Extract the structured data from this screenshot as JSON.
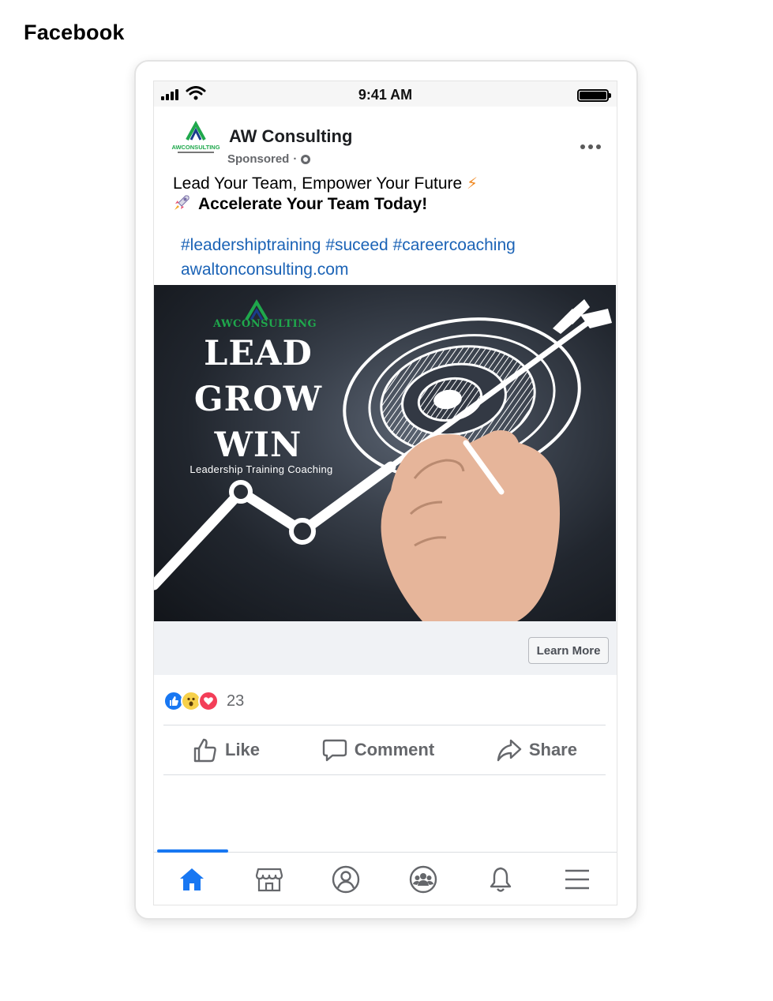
{
  "page_label": "Facebook",
  "status_bar": {
    "time": "9:41 AM"
  },
  "post": {
    "page_name": "AW Consulting",
    "sponsored": "Sponsored",
    "dot": "·",
    "avatar_logo_text": "AWCONSULTING",
    "text_line1": "Lead Your Team, Empower Your Future",
    "text_line2": "Accelerate Your Team Today!",
    "hashtags": [
      "#leadershiptraining",
      "#suceed",
      "#careercoaching"
    ],
    "link": "awaltonconsulting.com"
  },
  "ad_image": {
    "logo_text": "AWCONSULTING",
    "headline": [
      "LEAD",
      "GROW",
      "WIN"
    ],
    "subtitle": "Leadership Training Coaching"
  },
  "cta": {
    "label": "Learn More"
  },
  "reactions": {
    "count": "23",
    "types": [
      "like-icon",
      "wow-icon",
      "love-icon"
    ]
  },
  "actions": {
    "like": "Like",
    "comment": "Comment",
    "share": "Share"
  },
  "bottom_nav": [
    "home-icon",
    "marketplace-icon",
    "profile-icon",
    "groups-icon",
    "notifications-icon",
    "menu-icon"
  ],
  "colors": {
    "accent": "#1877f2",
    "link": "#1b63b6",
    "brand_green": "#1fa84c",
    "muted": "#65676b"
  }
}
